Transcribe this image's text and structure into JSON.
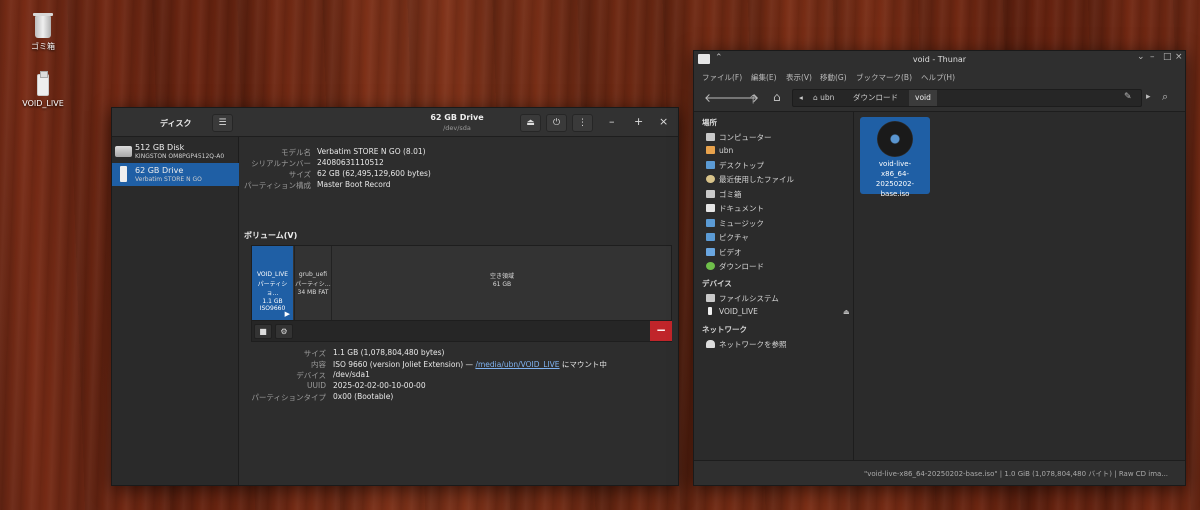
{
  "desktop": {
    "trash_label": "ゴミ箱",
    "usb_label": "VOID_LIVE"
  },
  "disks": {
    "sidebar_title": "ディスク",
    "menu_icon": "hamburger-icon",
    "drive_title": "62 GB Drive",
    "drive_path": "/dev/sda",
    "drives": [
      {
        "name": "512 GB Disk",
        "sub": "KINGSTON OM8PGP4512Q-A0"
      },
      {
        "name": "62 GB Drive",
        "sub": "Verbatim STORE N GO"
      }
    ],
    "info": [
      {
        "key": "モデル名",
        "value": "Verbatim STORE N GO (8.01)"
      },
      {
        "key": "シリアルナンバー",
        "value": "24080631110512"
      },
      {
        "key": "サイズ",
        "value": "62 GB (62,495,129,600 bytes)"
      },
      {
        "key": "パーティション構成",
        "value": "Master Boot Record"
      }
    ],
    "volumes_title": "ボリューム(V)",
    "segments": [
      {
        "l1": "VOID_LIVE",
        "l2": "パーティショ…",
        "l3": "1.1 GB ISO9660"
      },
      {
        "l1": "grub_uefi",
        "l2": "パーティシ…",
        "l3": "34 MB FAT"
      },
      {
        "l1": "空き領域",
        "l2": "61 GB"
      }
    ],
    "partition": {
      "size_key": "サイズ",
      "size_val": "1.1 GB (1,078,804,480 bytes)",
      "content_key": "内容",
      "content_pre": "ISO 9660 (version Joliet Extension) — ",
      "content_link": "/media/ubn/VOID_LIVE",
      "content_post": " にマウント中",
      "device_key": "デバイス",
      "device_val": "/dev/sda1",
      "uuid_key": "UUID",
      "uuid_val": "2025-02-02-00-10-00-00",
      "type_key": "パーティションタイプ",
      "type_val": "0x00 (Bootable)"
    }
  },
  "thunar": {
    "title": "void - Thunar",
    "menu": [
      "ファイル(F)",
      "編集(E)",
      "表示(V)",
      "移動(G)",
      "ブックマーク(B)",
      "ヘルプ(H)"
    ],
    "path": [
      "ubn",
      "ダウンロード",
      "void"
    ],
    "sections": {
      "places": "場所",
      "devices": "デバイス",
      "network": "ネットワーク"
    },
    "places": [
      "コンピューター",
      "ubn",
      "デスクトップ",
      "最近使用したファイル",
      "ゴミ箱",
      "ドキュメント",
      "ミュージック",
      "ピクチャ",
      "ビデオ",
      "ダウンロード"
    ],
    "devices": [
      "ファイルシステム",
      "VOID_LIVE"
    ],
    "network": [
      "ネットワークを参照"
    ],
    "file": {
      "name_l1": "void-live-",
      "name_l2": "x86_64-20250202-",
      "name_l3": "base.iso"
    },
    "status": "\"void-live-x86_64-20250202-base.iso\"  |  1.0 GiB (1,078,804,480 バイト)  |  Raw CD ima..."
  }
}
